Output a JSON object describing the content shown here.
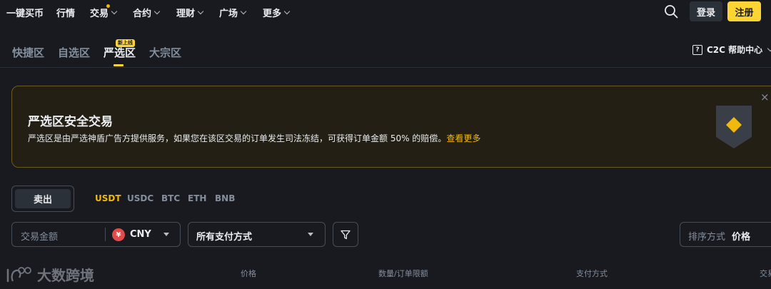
{
  "nav": {
    "items": [
      {
        "label": "一键买币"
      },
      {
        "label": "行情"
      },
      {
        "label": "交易"
      },
      {
        "label": "合约"
      },
      {
        "label": "理财"
      },
      {
        "label": "广场"
      },
      {
        "label": "更多"
      }
    ],
    "login_label": "登录",
    "register_label": "注册"
  },
  "zones": {
    "tabs": [
      {
        "label": "快捷区"
      },
      {
        "label": "自选区"
      },
      {
        "label": "严选区",
        "active": true
      },
      {
        "label": "大宗区"
      }
    ],
    "new_badge": "新上线",
    "help_label": "C2C 帮助中心",
    "help_icon": "question-icon"
  },
  "banner": {
    "title": "严选区安全交易",
    "description": "严选区是由严选神盾广告方提供服务，如果您在该区交易的订单发生司法冻结，可获得订单金额 50% 的赔偿。",
    "link": "查看更多",
    "close": "×",
    "icon": "shield-icon"
  },
  "trade": {
    "side_label": "卖出",
    "coins": [
      {
        "label": "USDT",
        "active": true
      },
      {
        "label": "USDC"
      },
      {
        "label": "BTC"
      },
      {
        "label": "ETH"
      },
      {
        "label": "BNB"
      }
    ]
  },
  "filters": {
    "amount_placeholder": "交易金额",
    "currency_symbol": "¥",
    "currency": "CNY",
    "payment": "所有支付方式",
    "filter_icon": "filter-icon",
    "sort_label": "排序方式",
    "sort_value": "价格"
  },
  "table": {
    "headers": [
      "价格",
      "数量/订单限额",
      "支付方式",
      "交易"
    ]
  },
  "watermark": {
    "text": "大数跨境"
  },
  "colors": {
    "background": "#181a20",
    "accent": "#fcd535",
    "link": "#f0b90b",
    "muted": "#848e9c"
  }
}
